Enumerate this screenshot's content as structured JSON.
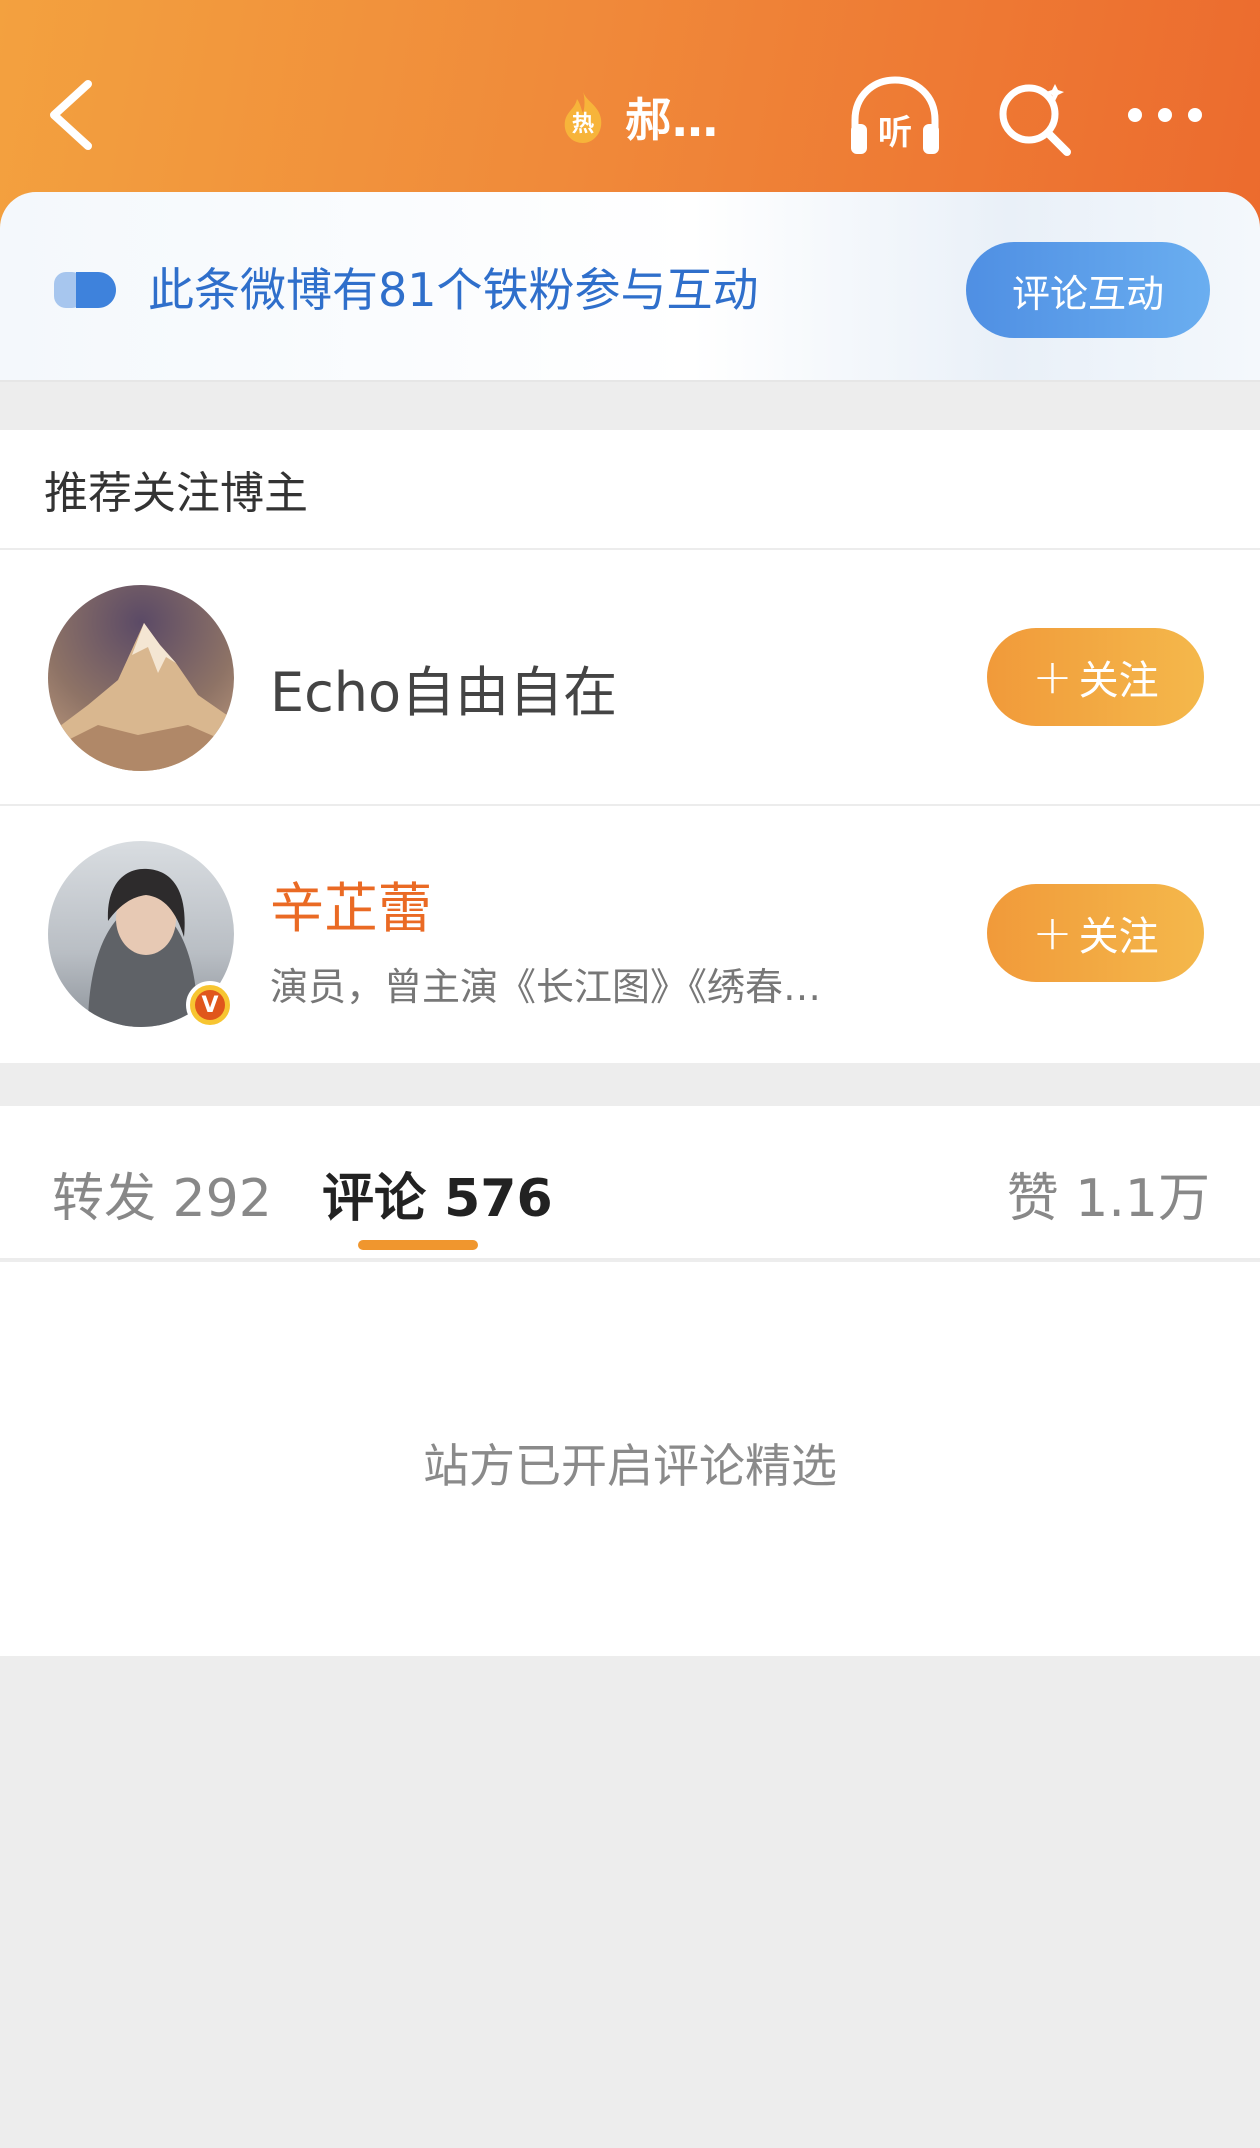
{
  "header": {
    "hot_badge": "热",
    "title": "郝…",
    "listen_icon_text": "听"
  },
  "fans_banner": {
    "text": "此条微博有81个铁粉参与互动",
    "button": "评论互动"
  },
  "recommend": {
    "heading": "推荐关注博主",
    "users": [
      {
        "name": "Echo自由自在",
        "description": "",
        "verified": false,
        "follow_label": "关注"
      },
      {
        "name": "辛芷蕾",
        "description": "演员，曾主演《长江图》《绣春…",
        "verified": true,
        "follow_label": "关注"
      }
    ],
    "verified_badge": "V"
  },
  "tabs": {
    "repost": "转发 292",
    "comment": "评论 576",
    "like": "赞 1.1万"
  },
  "comments": {
    "empty_text": "站方已开启评论精选"
  },
  "colors": {
    "header_gradient_start": "#f3a13f",
    "header_gradient_end": "#ec6b2e",
    "accent_blue": "#2f6fcb",
    "follow_orange": "#f19a3a",
    "vip_name": "#ea6a24"
  }
}
